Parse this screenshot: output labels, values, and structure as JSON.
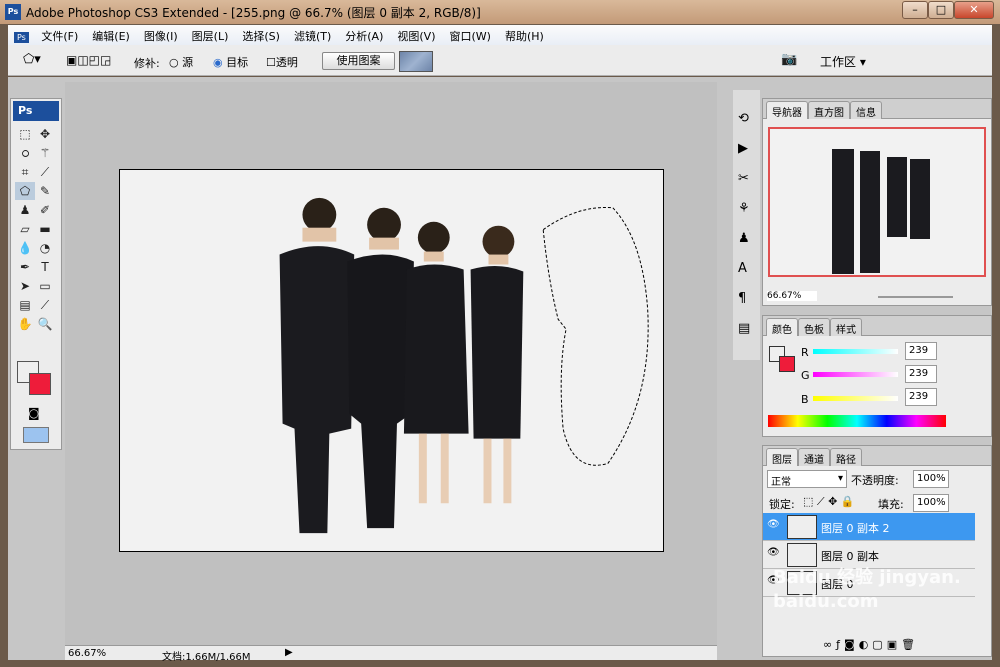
{
  "window": {
    "title": "Adobe Photoshop CS3 Extended - [255.png @ 66.7% (图层 0 副本 2, RGB/8)]",
    "logo": "Ps"
  },
  "menu": [
    "文件(F)",
    "编辑(E)",
    "图像(I)",
    "图层(L)",
    "选择(S)",
    "滤镜(T)",
    "分析(A)",
    "视图(V)",
    "窗口(W)",
    "帮助(H)"
  ],
  "options": {
    "patch_label": "修补:",
    "source": "源",
    "destination": "目标",
    "destination_selected": true,
    "transparent": "透明",
    "use_pattern": "使用图案",
    "workspace": "工作区 ▾"
  },
  "toolbox": {
    "logo": "Ps"
  },
  "status": {
    "zoom": "66.67%",
    "doc": "文档:1.66M/1.66M"
  },
  "navigator": {
    "tabs": [
      "导航器",
      "直方图",
      "信息"
    ],
    "zoom": "66.67%"
  },
  "color": {
    "tabs": [
      "颜色",
      "色板",
      "样式"
    ],
    "channels": [
      {
        "label": "R",
        "value": "239"
      },
      {
        "label": "G",
        "value": "239"
      },
      {
        "label": "B",
        "value": "239"
      }
    ],
    "foreground": "#efefef",
    "background": "#ee1c3a"
  },
  "layers": {
    "tabs": [
      "图层",
      "通道",
      "路径"
    ],
    "blend_mode": "正常",
    "opacity_label": "不透明度:",
    "opacity": "100%",
    "lock_label": "锁定:",
    "fill_label": "填充:",
    "fill": "100%",
    "items": [
      {
        "name": "图层 0 副本 2",
        "selected": true
      },
      {
        "name": "图层 0 副本",
        "selected": false
      },
      {
        "name": "图层 0",
        "selected": false
      }
    ]
  },
  "watermark": "Baidu 经验 jingyan.baidu.com"
}
